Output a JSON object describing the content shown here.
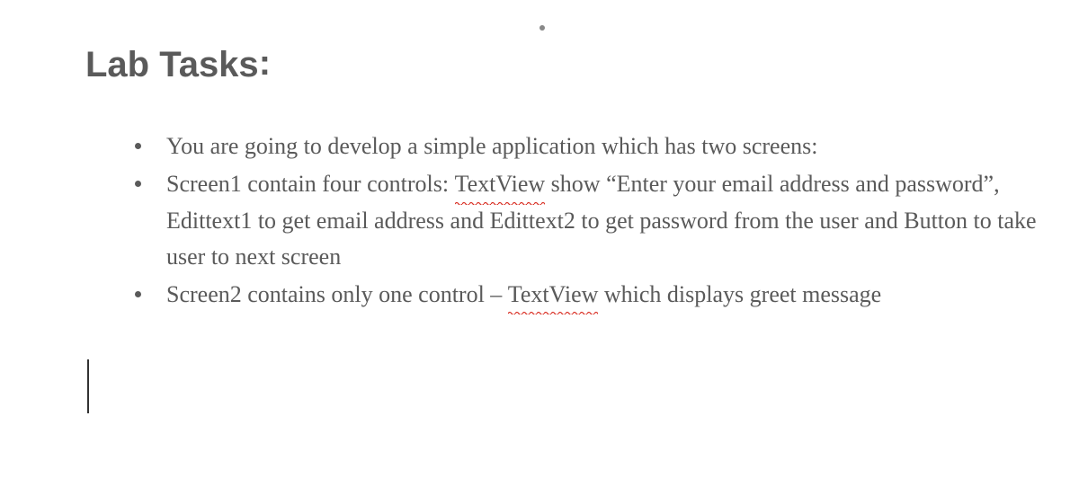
{
  "heading": {
    "text": "Lab Tasks",
    "punct": ":"
  },
  "bullets": [
    {
      "pre": "You are going to develop a  simple application which has two screens:",
      "spell": [],
      "post": ""
    },
    {
      "pre": "Screen1 contain four controls: ",
      "spell_word": "TextView",
      "post": " show “Enter your email address and password”, Edittext1 to get email address and Edittext2 to get password from the user and Button to take user to next screen"
    },
    {
      "pre": "Screen2 contains only one control – ",
      "spell_word": "TextView",
      "post": " which displays greet message"
    }
  ]
}
